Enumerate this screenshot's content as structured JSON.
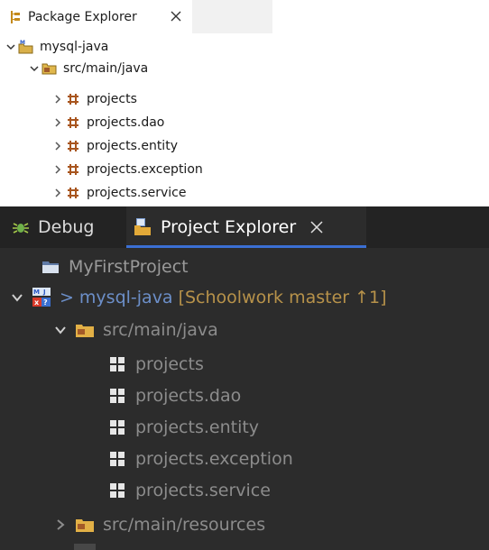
{
  "package_explorer": {
    "tab_label": "Package Explorer",
    "tree": {
      "project": "mysql-java",
      "source_folder": "src/main/java",
      "packages": [
        "projects",
        "projects.dao",
        "projects.entity",
        "projects.exception",
        "projects.service"
      ]
    }
  },
  "project_explorer": {
    "tabs": {
      "debug_label": "Debug",
      "project_label": "Project Explorer"
    },
    "tree": {
      "first_project": "MyFirstProject",
      "project_prefix": ">",
      "project": "mysql-java",
      "git_info": "[Schoolwork master ↑1]",
      "source_folder": "src/main/java",
      "packages": [
        "projects",
        "projects.dao",
        "projects.entity",
        "projects.exception",
        "projects.service"
      ],
      "resources_folder": "src/main/resources"
    }
  }
}
